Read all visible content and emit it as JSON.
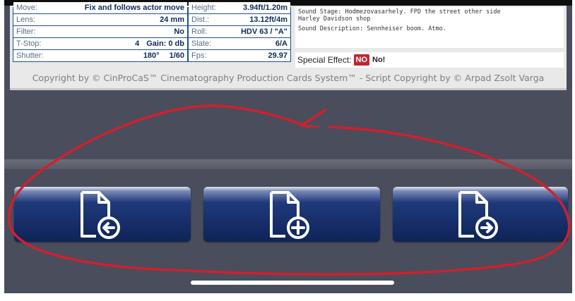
{
  "card": {
    "left_rows": [
      {
        "label": "Move:",
        "value": "Fix and follows actor move"
      },
      {
        "label": "Lens:",
        "value": "24 mm"
      },
      {
        "label": "Filter:",
        "value": "No"
      },
      {
        "label": "T-Stop:",
        "value": "4",
        "extra": "Gain: 0 db"
      },
      {
        "label": "Shutter:",
        "value": "180°",
        "extra": "1/60"
      }
    ],
    "right_rows": [
      {
        "label": "Height:",
        "value": "3.94ft/1.20m"
      },
      {
        "label": "Dist.:",
        "value": "13.12ft/4m"
      },
      {
        "label": "Roll:",
        "value": "HDV 63 / \"A\""
      },
      {
        "label": "Slate:",
        "value": "6/A"
      },
      {
        "label": "Fps:",
        "value": "29.97"
      }
    ],
    "sound_stage": "Sound Stage: Hodmezovasarhely. FPD the street  other side",
    "sound_stage_2": "Harley Davidson shop",
    "sound_description": "Sound Description: Sennheiser boom. Atmo.",
    "special_effect_label": "Special Effect:",
    "special_effect_badge": "NO",
    "special_effect_value": "No!",
    "copyright": "Copyright by © CinProCaS™ Cinematography Production Cards System™ - Script Copyright by © Arpad Zsolt Varga"
  },
  "toolbar": {
    "buttons": [
      {
        "name": "previous-card-button",
        "icon": "file-arrow-left-icon"
      },
      {
        "name": "add-card-button",
        "icon": "file-plus-icon"
      },
      {
        "name": "next-card-button",
        "icon": "file-arrow-right-icon"
      }
    ]
  },
  "colors": {
    "accent_blue": "#1e4f93",
    "button_navy": "#142a64",
    "badge_red": "#c0262d",
    "background": "#4a4d5c",
    "annotation_red": "#d0202e"
  }
}
